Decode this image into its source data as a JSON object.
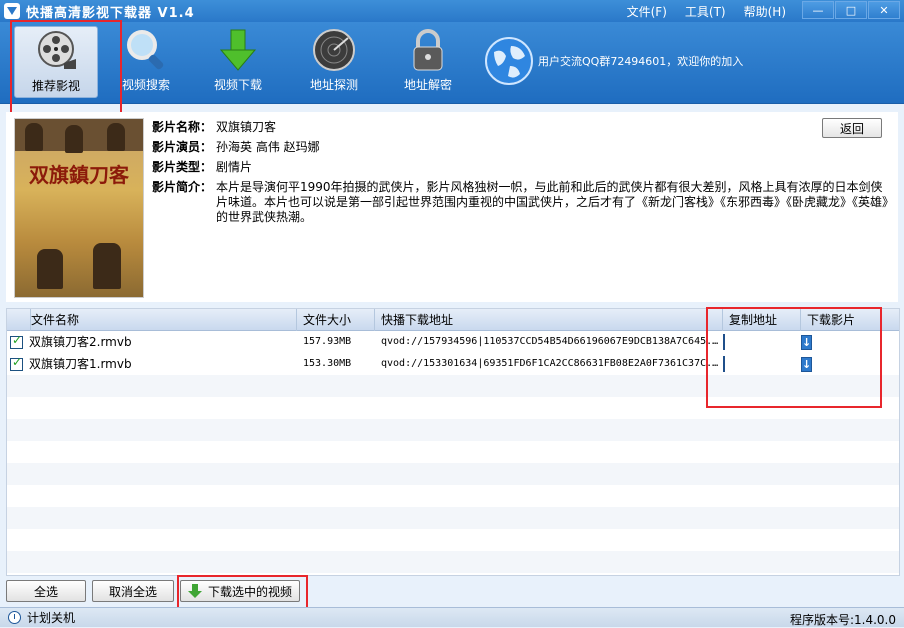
{
  "app": {
    "title": "快播高清影视下载器 V1.4",
    "menu": [
      "文件(F)",
      "工具(T)",
      "帮助(H)"
    ],
    "window_controls": [
      "—",
      "□",
      "✕"
    ]
  },
  "toolbar": {
    "items": [
      {
        "label": "推荐影视",
        "icon": "film-reel-icon",
        "active": true
      },
      {
        "label": "视频搜索",
        "icon": "magnifier-icon"
      },
      {
        "label": "视频下载",
        "icon": "download-arrow-icon"
      },
      {
        "label": "地址探测",
        "icon": "radar-icon"
      },
      {
        "label": "地址解密",
        "icon": "padlock-icon"
      }
    ],
    "community_text": "用户交流QQ群72494601，欢迎你的加入"
  },
  "movie": {
    "name_label": "影片名称：",
    "name": "双旗镇刀客",
    "actors_label": "影片演员：",
    "actors": "孙海英 高伟 赵玛娜",
    "type_label": "影片类型：",
    "type": "剧情片",
    "intro_label": "影片简介：",
    "intro": "本片是导演何平1990年拍摄的武侠片，影片风格独树一帜，与此前和此后的武侠片都有很大差别，风格上具有浓厚的日本剑侠片味道。本片也可以说是第一部引起世界范围内重视的中国武侠片，之后才有了《新龙门客栈》《东邪西毒》《卧虎藏龙》《英雄》的世界武侠热潮。",
    "poster_title": "双旗鎮刀客",
    "back_label": "返回"
  },
  "table": {
    "columns": [
      "文件名称",
      "文件大小",
      "快播下载地址",
      "复制地址",
      "下载影片"
    ],
    "rows": [
      {
        "checked": true,
        "name": "双旗镇刀客2.rmvb",
        "size": "157.93MB",
        "url": "qvod://157934596|110537CCD54B54D66196067E9DCB138A7C645..."
      },
      {
        "checked": true,
        "name": "双旗镇刀客1.rmvb",
        "size": "153.30MB",
        "url": "qvod://153301634|69351FD6F1CA2CC86631FB08E2A0F7361C37C..."
      }
    ]
  },
  "buttons": {
    "select_all": "全选",
    "deselect_all": "取消全选",
    "download_selected": "下载选中的视频"
  },
  "status": {
    "schedule": "计划关机",
    "version": "程序版本号:1.4.0.0"
  },
  "colors": {
    "toolbar": "#2a78c9",
    "highlight": "#e8262c"
  }
}
